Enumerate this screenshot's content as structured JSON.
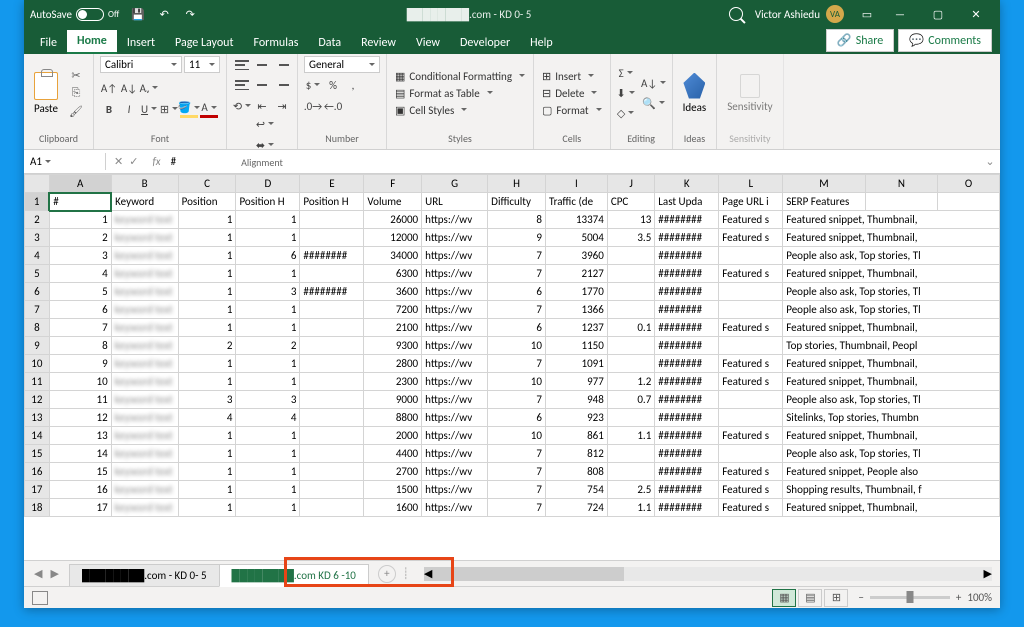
{
  "titlebar": {
    "autosave_label": "AutoSave",
    "autosave_state": "Off",
    "doc_title": "████████.com - KD 0- 5",
    "user_name": "Victor Ashiedu",
    "user_initials": "VA"
  },
  "tabs": {
    "file": "File",
    "home": "Home",
    "insert": "Insert",
    "pagelayout": "Page Layout",
    "formulas": "Formulas",
    "data": "Data",
    "review": "Review",
    "view": "View",
    "developer": "Developer",
    "help": "Help",
    "share": "Share",
    "comments": "Comments"
  },
  "ribbon": {
    "clipboard": "Clipboard",
    "paste": "Paste",
    "font": "Font",
    "font_name": "Calibri",
    "font_size": "11",
    "alignment": "Alignment",
    "number": "Number",
    "number_format": "General",
    "styles": "Styles",
    "cond_fmt": "Conditional Formatting",
    "fmt_table": "Format as Table",
    "cell_styles": "Cell Styles",
    "cells": "Cells",
    "insert_btn": "Insert",
    "delete_btn": "Delete",
    "format_btn": "Format",
    "editing": "Editing",
    "ideas": "Ideas",
    "sensitivity": "Sensitivity"
  },
  "formula_bar": {
    "cell_ref": "A1",
    "formula": "#"
  },
  "columns": [
    "A",
    "B",
    "C",
    "D",
    "E",
    "F",
    "G",
    "H",
    "I",
    "J",
    "K",
    "L",
    "M",
    "N",
    "O"
  ],
  "headers": {
    "A": "#",
    "B": "Keyword",
    "C": "Position",
    "D": "Position H",
    "E": "Position H",
    "F": "Volume",
    "G": "URL",
    "H": "Difficulty",
    "I": "Traffic (de",
    "J": "CPC",
    "K": "Last Upda",
    "L": "Page URL i",
    "M": "SERP Features",
    "N": "",
    "O": ""
  },
  "rows": [
    {
      "n": 1,
      "c": 1,
      "d": 1,
      "e": "",
      "f": 26000,
      "g": "https://wv",
      "h": 8,
      "i": 13374,
      "j": "13",
      "k": "########",
      "l": "Featured s",
      "m": "Featured snippet, Thumbnail,"
    },
    {
      "n": 2,
      "c": 1,
      "d": 1,
      "e": "",
      "f": 12000,
      "g": "https://wv",
      "h": 9,
      "i": 5004,
      "j": "3.5",
      "k": "########",
      "l": "Featured s",
      "m": "Featured snippet, Thumbnail,"
    },
    {
      "n": 3,
      "c": 1,
      "d": 6,
      "e": "########",
      "f": 34000,
      "g": "https://wv",
      "h": 7,
      "i": 3960,
      "j": "",
      "k": "########",
      "l": "",
      "m": "People also ask, Top stories, Tl"
    },
    {
      "n": 4,
      "c": 1,
      "d": 1,
      "e": "",
      "f": 6300,
      "g": "https://wv",
      "h": 7,
      "i": 2127,
      "j": "",
      "k": "########",
      "l": "Featured s",
      "m": "Featured snippet, Thumbnail,"
    },
    {
      "n": 5,
      "c": 1,
      "d": 3,
      "e": "########",
      "f": 3600,
      "g": "https://wv",
      "h": 6,
      "i": 1770,
      "j": "",
      "k": "########",
      "l": "",
      "m": "People also ask, Top stories, Tl"
    },
    {
      "n": 6,
      "c": 1,
      "d": 1,
      "e": "",
      "f": 7200,
      "g": "https://wv",
      "h": 7,
      "i": 1366,
      "j": "",
      "k": "########",
      "l": "",
      "m": "People also ask, Top stories, Tl"
    },
    {
      "n": 7,
      "c": 1,
      "d": 1,
      "e": "",
      "f": 2100,
      "g": "https://wv",
      "h": 6,
      "i": 1237,
      "j": "0.1",
      "k": "########",
      "l": "Featured s",
      "m": "Featured snippet, Thumbnail,"
    },
    {
      "n": 8,
      "c": 2,
      "d": 2,
      "e": "",
      "f": 9300,
      "g": "https://wv",
      "h": 10,
      "i": 1150,
      "j": "",
      "k": "########",
      "l": "",
      "m": "Top stories, Thumbnail, Peopl"
    },
    {
      "n": 9,
      "c": 1,
      "d": 1,
      "e": "",
      "f": 2800,
      "g": "https://wv",
      "h": 7,
      "i": 1091,
      "j": "",
      "k": "########",
      "l": "Featured s",
      "m": "Featured snippet, Thumbnail,"
    },
    {
      "n": 10,
      "c": 1,
      "d": 1,
      "e": "",
      "f": 2300,
      "g": "https://wv",
      "h": 10,
      "i": 977,
      "j": "1.2",
      "k": "########",
      "l": "Featured s",
      "m": "Featured snippet, Thumbnail,"
    },
    {
      "n": 11,
      "c": 3,
      "d": 3,
      "e": "",
      "f": 9000,
      "g": "https://wv",
      "h": 7,
      "i": 948,
      "j": "0.7",
      "k": "########",
      "l": "",
      "m": "People also ask, Top stories, Tl"
    },
    {
      "n": 12,
      "c": 4,
      "d": 4,
      "e": "",
      "f": 8800,
      "g": "https://wv",
      "h": 6,
      "i": 923,
      "j": "",
      "k": "########",
      "l": "",
      "m": "Sitelinks, Top stories, Thumbn"
    },
    {
      "n": 13,
      "c": 1,
      "d": 1,
      "e": "",
      "f": 2000,
      "g": "https://wv",
      "h": 10,
      "i": 861,
      "j": "1.1",
      "k": "########",
      "l": "Featured s",
      "m": "Featured snippet, Thumbnail,"
    },
    {
      "n": 14,
      "c": 1,
      "d": 1,
      "e": "",
      "f": 4400,
      "g": "https://wv",
      "h": 7,
      "i": 812,
      "j": "",
      "k": "########",
      "l": "",
      "m": "People also ask, Top stories, Tl"
    },
    {
      "n": 15,
      "c": 1,
      "d": 1,
      "e": "",
      "f": 2700,
      "g": "https://wv",
      "h": 7,
      "i": 808,
      "j": "",
      "k": "########",
      "l": "Featured s",
      "m": "Featured snippet, People also"
    },
    {
      "n": 16,
      "c": 1,
      "d": 1,
      "e": "",
      "f": 1500,
      "g": "https://wv",
      "h": 7,
      "i": 754,
      "j": "2.5",
      "k": "########",
      "l": "Featured s",
      "m": "Shopping results, Thumbnail, f"
    },
    {
      "n": 17,
      "c": 1,
      "d": 1,
      "e": "",
      "f": 1600,
      "g": "https://wv",
      "h": 7,
      "i": 724,
      "j": "1.1",
      "k": "########",
      "l": "Featured s",
      "m": "Featured snippet, Thumbnail,"
    }
  ],
  "sheets": {
    "s1": "████████.com - KD 0- 5",
    "s2": "████████.com KD 6 -10"
  },
  "status": {
    "zoom": "100%"
  }
}
